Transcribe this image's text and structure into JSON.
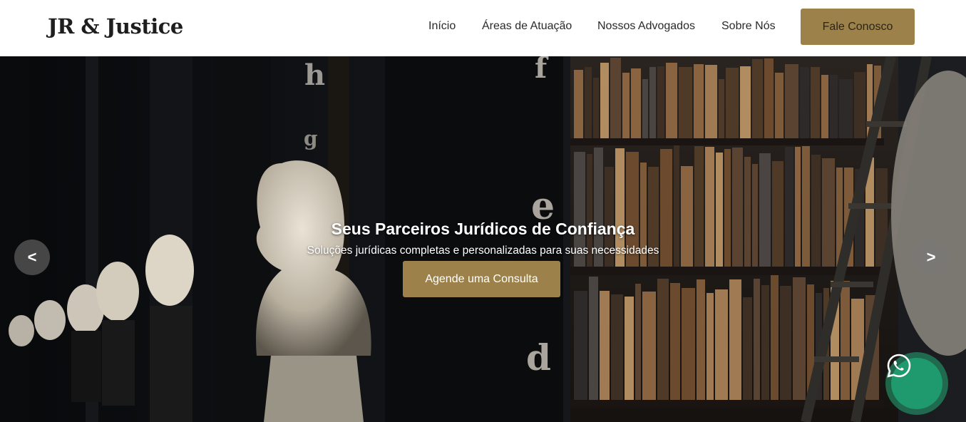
{
  "brand": {
    "logo": "JR & Justice"
  },
  "nav": {
    "items": [
      {
        "label": "Início"
      },
      {
        "label": "Áreas de Atuação"
      },
      {
        "label": "Nossos Advogados"
      },
      {
        "label": "Sobre Nós"
      }
    ],
    "cta_label": "Fale Conosco"
  },
  "hero": {
    "title": "Seus Parceiros Jurídicos de Confiança",
    "subtitle": "Soluções jurídicas completas e personalizadas para suas necessidades",
    "button_label": "Agende uma Consulta",
    "prev_label": "<",
    "next_label": ">"
  },
  "colors": {
    "accent": "#9c824a",
    "header_bg": "#ffffff",
    "whatsapp": "#1f9a6e"
  },
  "icons": {
    "whatsapp": "whatsapp-icon"
  }
}
